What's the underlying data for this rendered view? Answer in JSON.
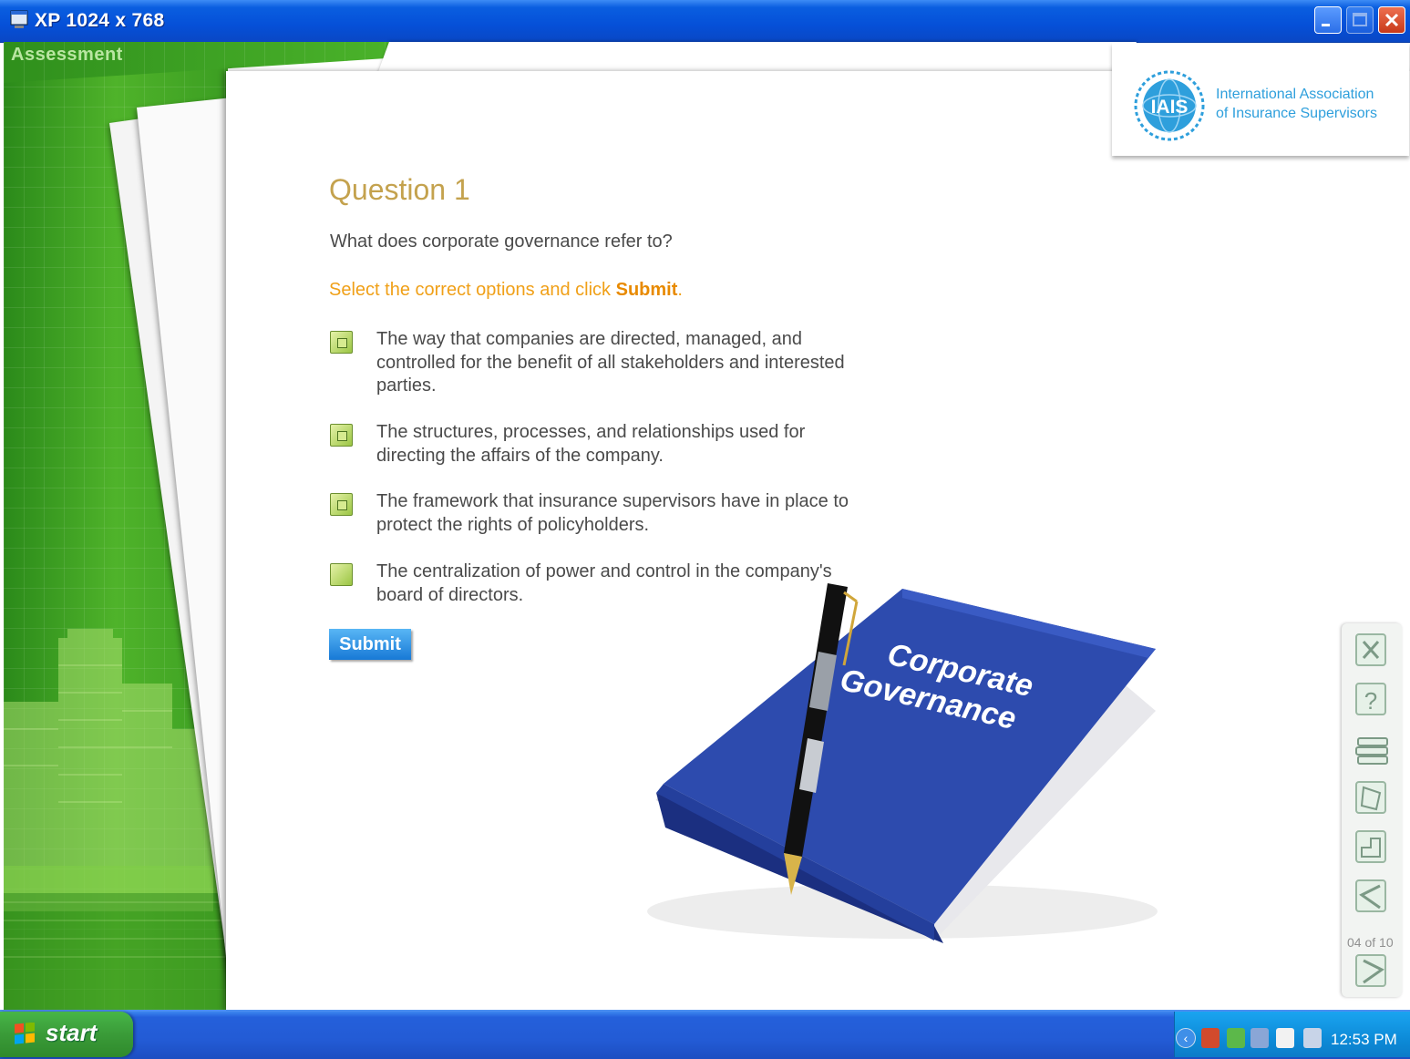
{
  "window": {
    "title": "XP 1024 x 768",
    "icon": "app-window-icon",
    "controls": [
      "minimize-icon",
      "maximize-icon",
      "close-icon"
    ]
  },
  "course": {
    "section_label": "Assessment",
    "logo": {
      "emblem_text": "IAIS",
      "name_line1": "International Association",
      "name_line2": "of Insurance Supervisors"
    }
  },
  "question": {
    "title": "Question 1",
    "prompt": "What does corporate governance refer to?",
    "instruction_prefix": "Select the correct options and click ",
    "instruction_action": "Submit",
    "instruction_suffix": ".",
    "options": [
      {
        "text": "The way that companies are directed, managed, and controlled for the benefit of all stakeholders and interested parties.",
        "checked": true
      },
      {
        "text": "The structures, processes, and relationships used for directing the affairs of the company.",
        "checked": true
      },
      {
        "text": "The framework that insurance supervisors have in place to protect the rights of policyholders.",
        "checked": true
      },
      {
        "text": "The centralization of power and control in the company's board of directors.",
        "checked": false
      }
    ],
    "submit_label": "Submit"
  },
  "illustration": {
    "book_title_line1": "Corporate",
    "book_title_line2": "Governance"
  },
  "toolbar": {
    "buttons": [
      "exit-icon",
      "help-icon",
      "resources-icon",
      "glossary-icon",
      "home-icon",
      "back-icon",
      "next-icon"
    ],
    "page_counter": "04 of 10"
  },
  "taskbar": {
    "start_label": "start",
    "clock": "12:53 PM",
    "tray_icons": [
      "show-hidden-icons-icon",
      "shield-icon",
      "network-icon",
      "monitor-icon",
      "pen-icon",
      "volume-icon"
    ]
  }
}
